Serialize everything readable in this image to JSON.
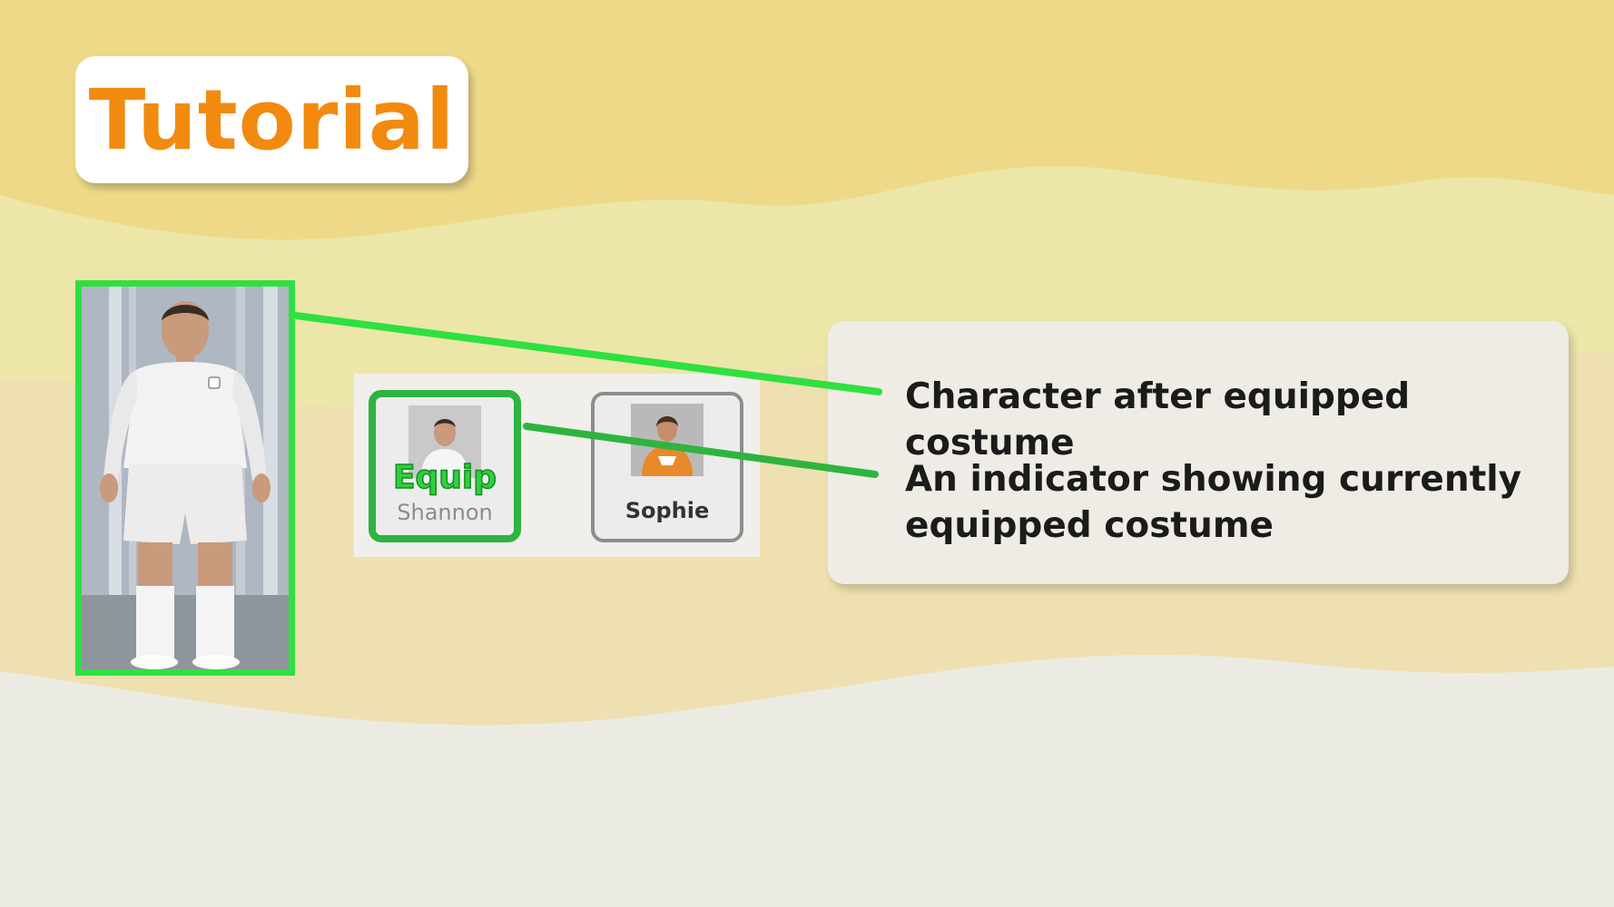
{
  "header": {
    "title": "Tutorial"
  },
  "costumes": [
    {
      "name": "Shannon",
      "equip_label": "Equip",
      "equipped": true
    },
    {
      "name": "Sophie",
      "equipped": false
    }
  ],
  "annotations": [
    {
      "text": "Character after equipped costume"
    },
    {
      "text": "An indicator showing currently equipped costume"
    }
  ],
  "colors": {
    "title": "#f28a0f",
    "highlight_bright": "#2ee040",
    "highlight_dark": "#2eb43f",
    "bg_top": "#eed988",
    "bg_mid": "#ece6a8",
    "bg_low": "#eee0b0",
    "bg_bottom": "#ecebe3"
  }
}
